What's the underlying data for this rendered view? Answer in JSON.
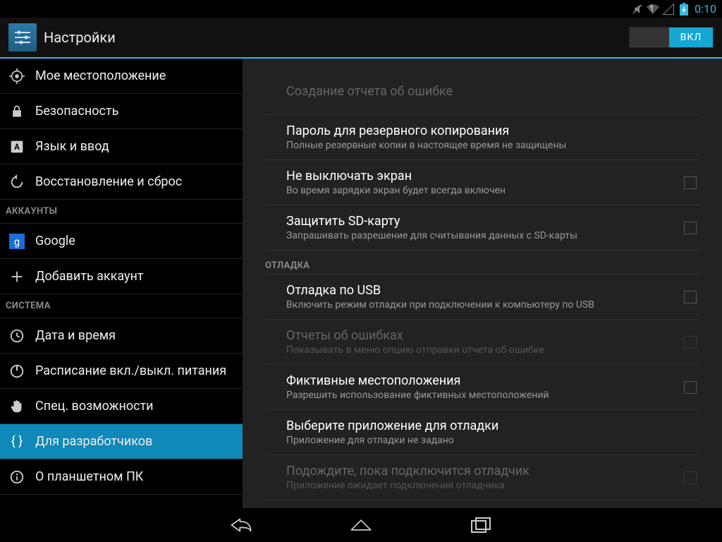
{
  "statusbar": {
    "clock": "0:10"
  },
  "header": {
    "title": "Настройки",
    "toggle": "ВКЛ"
  },
  "sidebar": {
    "items": [
      {
        "icon": "location",
        "label": "Мое местоположение"
      },
      {
        "icon": "lock",
        "label": "Безопасность"
      },
      {
        "icon": "lang",
        "label": "Язык и ввод"
      },
      {
        "icon": "reset",
        "label": "Восстановление и сброс"
      }
    ],
    "heading_accounts": "АККАУНТЫ",
    "accounts": [
      {
        "icon": "google",
        "label": "Google"
      },
      {
        "icon": "plus",
        "label": "Добавить аккаунт"
      }
    ],
    "heading_system": "СИСТЕМА",
    "system": [
      {
        "icon": "clock",
        "label": "Дата и время"
      },
      {
        "icon": "power",
        "label": "Расписание вкл./выкл. питания"
      },
      {
        "icon": "hand",
        "label": "Спец. возможности"
      },
      {
        "icon": "braces",
        "label": "Для разработчиков"
      },
      {
        "icon": "info",
        "label": "О планшетном ПК"
      }
    ]
  },
  "content": {
    "prefs1": [
      {
        "title": "Создание отчета об ошибке",
        "sub": "",
        "disabled": true,
        "checkbox": false
      },
      {
        "title": "Пароль для резервного копирования",
        "sub": "Полные резервные копии в настоящее время не защищены",
        "disabled": false,
        "checkbox": false
      },
      {
        "title": "Не выключать экран",
        "sub": "Во время зарядки экран будет всегда включен",
        "disabled": false,
        "checkbox": true
      },
      {
        "title": "Защитить SD-карту",
        "sub": "Запрашивать разрешение для считывания данных с SD-карты",
        "disabled": false,
        "checkbox": true
      }
    ],
    "heading_debug": "ОТЛАДКА",
    "prefs2": [
      {
        "title": "Отладка по USB",
        "sub": "Включить режим отладки при подключении к компьютеру по USB",
        "disabled": false,
        "checkbox": true
      },
      {
        "title": "Отчеты об ошибках",
        "sub": "Показывать в меню опцию отправки отчета об ошибке",
        "disabled": true,
        "checkbox": true
      },
      {
        "title": "Фиктивные местоположения",
        "sub": "Разрешить использование фиктивных местоположений",
        "disabled": false,
        "checkbox": true
      },
      {
        "title": "Выберите приложение для отладки",
        "sub": "Приложение для отладки не задано",
        "disabled": false,
        "checkbox": false
      },
      {
        "title": "Подождите, пока подключится отладчик",
        "sub": "Приложение ожидает подключения отладчика",
        "disabled": true,
        "checkbox": true
      }
    ]
  }
}
